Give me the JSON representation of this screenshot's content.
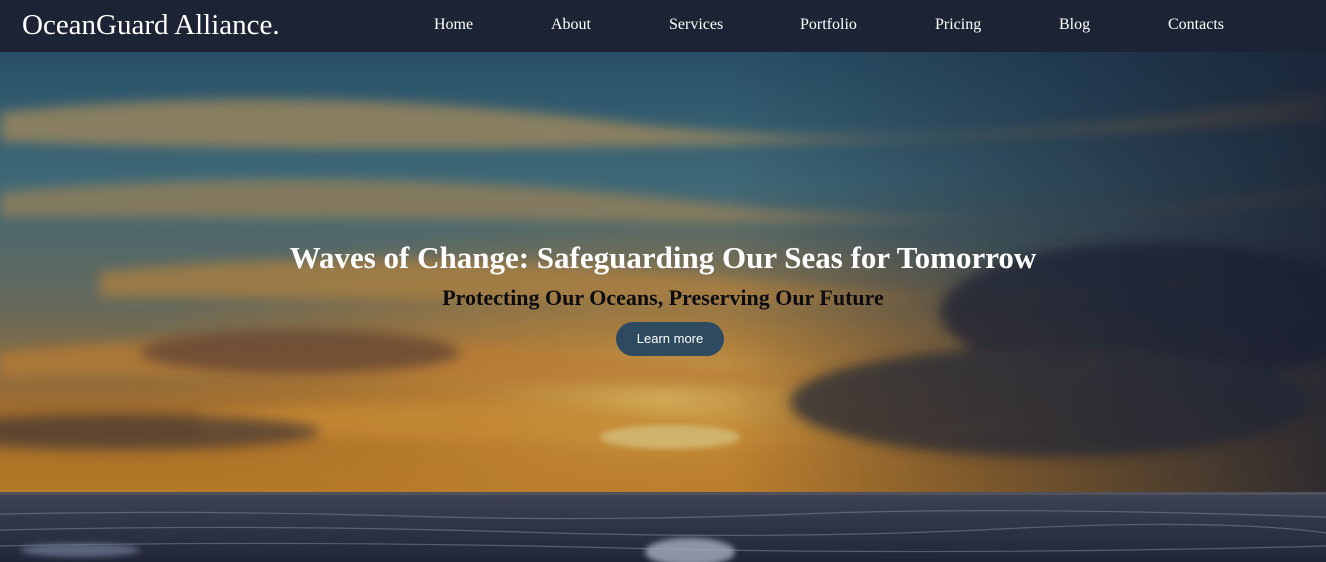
{
  "header": {
    "brand": "OceanGuard Alliance.",
    "nav": [
      {
        "label": "Home"
      },
      {
        "label": "About"
      },
      {
        "label": "Services"
      },
      {
        "label": "Portfolio"
      },
      {
        "label": "Pricing"
      },
      {
        "label": "Blog"
      },
      {
        "label": "Contacts"
      }
    ]
  },
  "hero": {
    "title": "Waves of Change: Safeguarding Our Seas for Tomorrow",
    "subtitle": "Protecting Our Oceans, Preserving Our Future",
    "cta_label": "Learn more"
  },
  "colors": {
    "navbar_bg": "#1c2335",
    "cta_bg": "#2d4a60",
    "nav_text": "#ffffff",
    "subtitle_text": "#0c0c10"
  }
}
